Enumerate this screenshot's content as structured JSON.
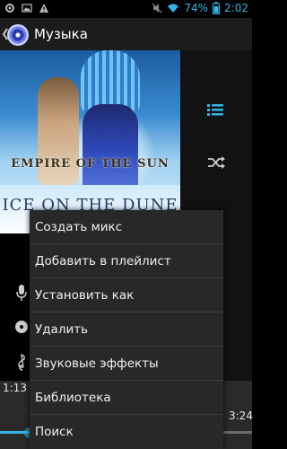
{
  "status_bar": {
    "battery_percent": "74%",
    "time": "2:02",
    "accent_color": "#33b5e5",
    "icons": [
      "settings-icon",
      "image-icon",
      "warning-icon",
      "mute-icon",
      "wifi-icon",
      "battery-icon"
    ]
  },
  "action_bar": {
    "title": "Музыка",
    "icons": [
      "back-chevron-icon",
      "music-app-icon"
    ]
  },
  "album_art": {
    "artist_logo": "EMPIRE OF THE SUN",
    "artist_logo_small": "OF THE",
    "album_title": "ICE ON THE DUNE"
  },
  "side_controls": {
    "icons": [
      "now-playing-list-icon",
      "shuffle-icon",
      "microphone-icon",
      "disc-icon",
      "treble-clef-icon"
    ]
  },
  "playback": {
    "elapsed": "1:13",
    "duration": "3:24"
  },
  "menu": {
    "items": [
      {
        "label": "Создать микс"
      },
      {
        "label": "Добавить в плейлист"
      },
      {
        "label": "Установить как"
      },
      {
        "label": "Удалить"
      },
      {
        "label": "Звуковые эффекты"
      },
      {
        "label": "Библиотека"
      },
      {
        "label": "Поиск"
      }
    ]
  }
}
